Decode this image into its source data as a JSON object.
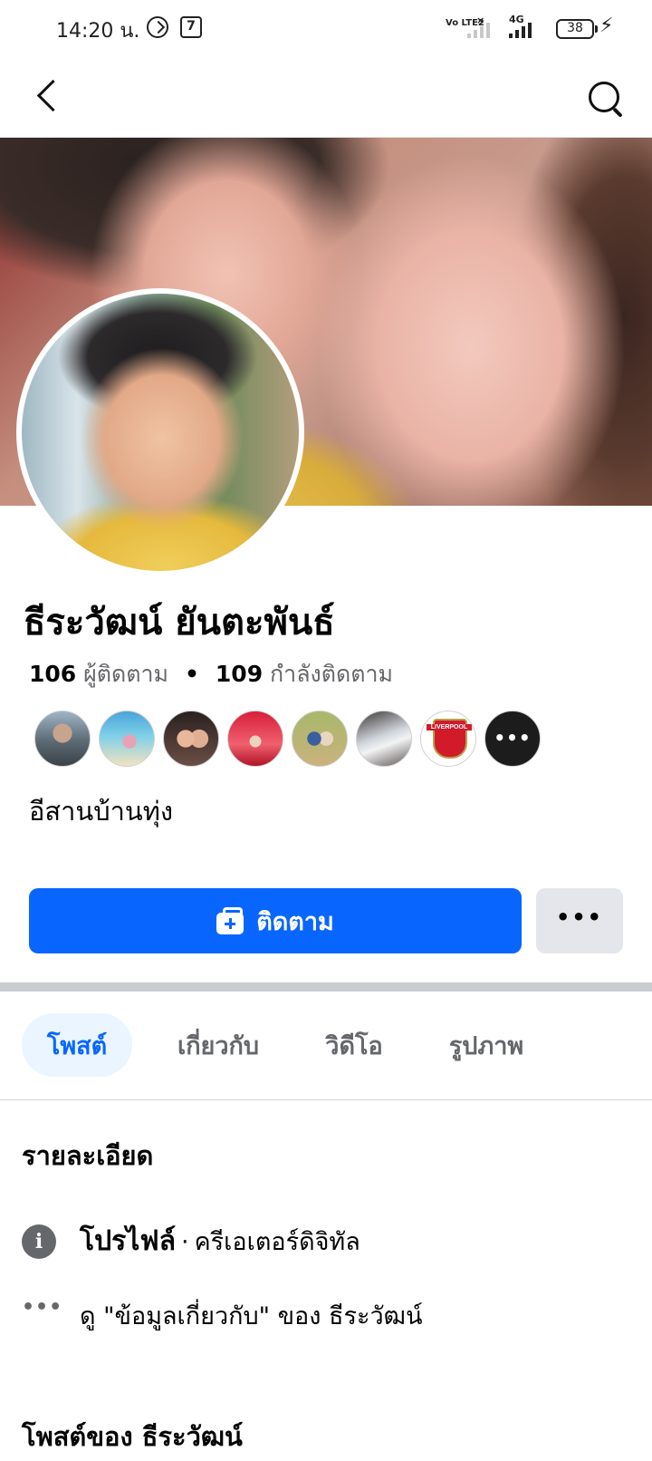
{
  "status_bar": {
    "time": "14:20 น.",
    "volte": "Vo LTE2",
    "network": "4G",
    "battery": "38"
  },
  "header": {
    "back_icon": "back-arrow-icon",
    "search_icon": "search-icon"
  },
  "profile": {
    "name": "ธีระวัฒน์ ยันตะพันธ์",
    "followers_count": "106",
    "followers_label": "ผู้ติดตาม",
    "following_count": "109",
    "following_label": "กำลังติดตาม",
    "bio": "อีสานบ้านทุ่ง"
  },
  "followers_preview": {
    "badge_text": "LIVERPOOL",
    "more_label": "•••"
  },
  "actions": {
    "follow_label": "ติดตาม",
    "more_label": "•••"
  },
  "tabs": [
    {
      "label": "โพสต์",
      "active": true
    },
    {
      "label": "เกี่ยวกับ",
      "active": false
    },
    {
      "label": "วิดีโอ",
      "active": false
    },
    {
      "label": "รูปภาพ",
      "active": false
    }
  ],
  "details": {
    "title": "รายละเอียด",
    "profile_type_label": "โปรไฟล์",
    "profile_type_value": "ครีเอเตอร์ดิจิทัล",
    "see_about": "ดู \"ข้อมูลเกี่ยวกับ\" ของ ธีระวัฒน์"
  },
  "posts_section": {
    "title": "โพสต์ของ ธีระวัฒน์"
  },
  "colors": {
    "primary": "#0866ff",
    "tab_active_bg": "#ebf5ff",
    "secondary_text": "#65676b",
    "button_gray": "#e4e6eb"
  }
}
